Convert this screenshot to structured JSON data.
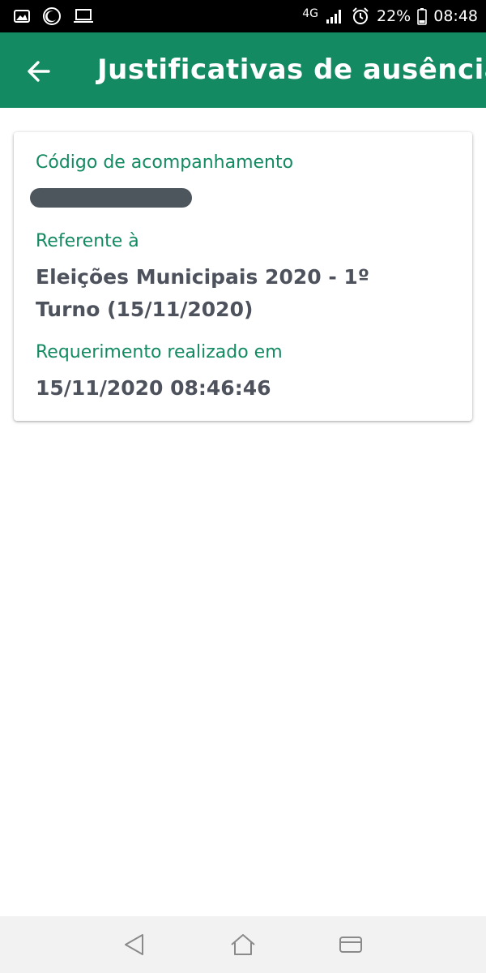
{
  "status_bar": {
    "network": "4G",
    "battery": "22%",
    "time": "08:48",
    "icons": [
      "image-icon",
      "moon-icon",
      "laptop-icon",
      "signal-icon",
      "alarm-icon",
      "battery-icon"
    ]
  },
  "header": {
    "title": "Justificativas de ausência",
    "back_icon": "arrow-left-icon"
  },
  "card": {
    "tracking_label": "Código de acompanhamento",
    "reference_label": "Referente à",
    "reference_value": "Eleições Municipais 2020 - 1º Turno (15/11/2020)",
    "request_label": "Requerimento realizado em",
    "request_value": "15/11/2020 08:46:46"
  },
  "nav_bar": {
    "icons": [
      "back-triangle-icon",
      "home-icon",
      "recents-icon"
    ]
  },
  "colors": {
    "brand_green": "#138a61",
    "text_dark": "#4d525c",
    "status_bar": "#000000"
  }
}
